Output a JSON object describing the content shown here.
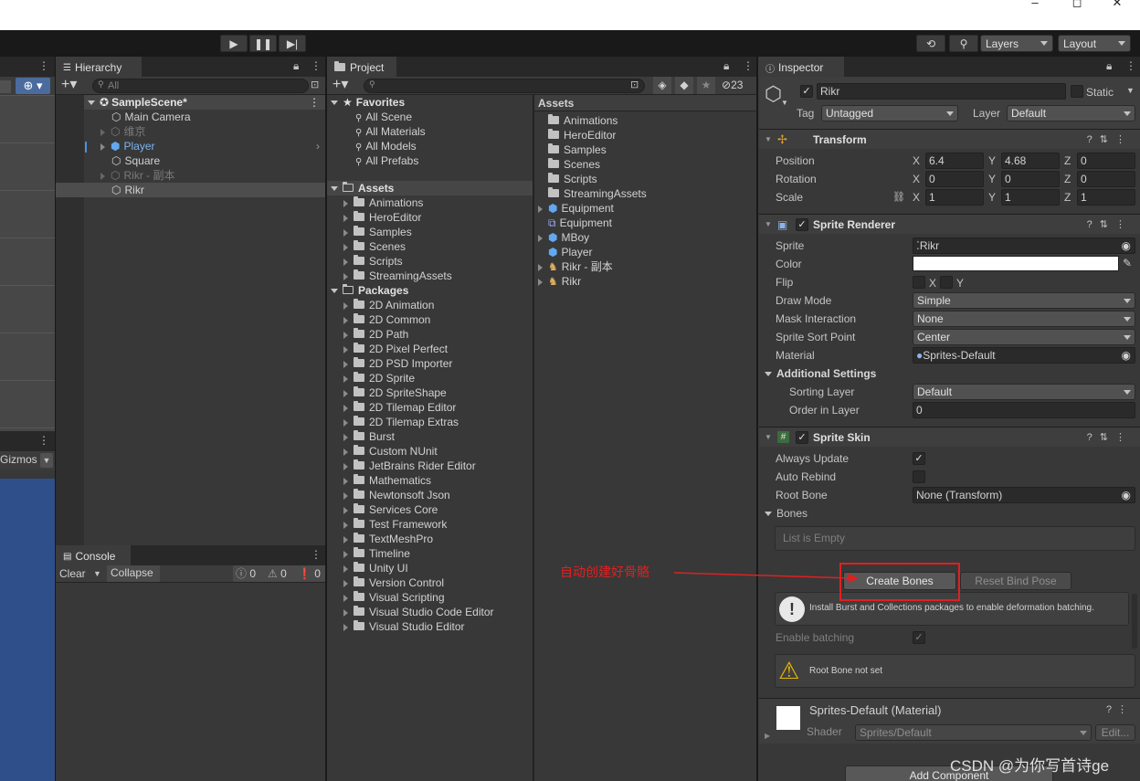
{
  "toolbar": {
    "play_icon": "play-icon",
    "pause_icon": "pause-icon",
    "step_icon": "step-icon",
    "layers": "Layers",
    "layout": "Layout"
  },
  "scene": {
    "gizmos": "Gizmos"
  },
  "hierarchy": {
    "tab": "Hierarchy",
    "search_placeholder": "All",
    "scene": "SampleScene*",
    "items": [
      "Main Camera",
      "维京",
      "Player",
      "Square",
      "Rikr - 副本",
      "Rikr"
    ]
  },
  "console": {
    "tab": "Console",
    "clear": "Clear",
    "collapse": "Collapse",
    "info_count": "0",
    "warn_count": "0",
    "error_count": "0"
  },
  "project": {
    "tab": "Project",
    "hidden_count": "23",
    "favorites_label": "Favorites",
    "favorites": [
      "All Scene",
      "All Materials",
      "All Models",
      "All Prefabs"
    ],
    "assets_label": "Assets",
    "assets_folders": [
      "Animations",
      "HeroEditor",
      "Samples",
      "Scenes",
      "Scripts",
      "StreamingAssets"
    ],
    "packages_label": "Packages",
    "packages": [
      "2D Animation",
      "2D Common",
      "2D Path",
      "2D Pixel Perfect",
      "2D PSD Importer",
      "2D Sprite",
      "2D SpriteShape",
      "2D Tilemap Editor",
      "2D Tilemap Extras",
      "Burst",
      "Custom NUnit",
      "JetBrains Rider Editor",
      "Mathematics",
      "Newtonsoft Json",
      "Services Core",
      "Test Framework",
      "TextMeshPro",
      "Timeline",
      "Unity UI",
      "Version Control",
      "Visual Scripting",
      "Visual Studio Code Editor",
      "Visual Studio Editor"
    ],
    "grid_header": "Assets",
    "grid_items": [
      "Animations",
      "HeroEditor",
      "Samples",
      "Scenes",
      "Scripts",
      "StreamingAssets",
      "Equipment",
      "Equipment",
      "MBoy",
      "Player",
      "Rikr - 副本",
      "Rikr"
    ]
  },
  "inspector": {
    "tab": "Inspector",
    "object_name": "Rikr",
    "static_label": "Static",
    "tag_label": "Tag",
    "tag_value": "Untagged",
    "layer_label": "Layer",
    "layer_value": "Default",
    "transform": {
      "title": "Transform",
      "position_label": "Position",
      "rotation_label": "Rotation",
      "scale_label": "Scale",
      "x": "X",
      "y": "Y",
      "z": "Z",
      "pos": [
        "6.4",
        "4.68",
        "0"
      ],
      "rot": [
        "0",
        "0",
        "0"
      ],
      "scale": [
        "1",
        "1",
        "1"
      ]
    },
    "sprite_renderer": {
      "title": "Sprite Renderer",
      "sprite_label": "Sprite",
      "sprite_value": "Rikr",
      "color_label": "Color",
      "color_value": "#ffffff",
      "flip_label": "Flip",
      "flip_x": "X",
      "flip_y": "Y",
      "draw_mode_label": "Draw Mode",
      "draw_mode_value": "Simple",
      "mask_label": "Mask Interaction",
      "mask_value": "None",
      "sort_point_label": "Sprite Sort Point",
      "sort_point_value": "Center",
      "material_label": "Material",
      "material_value": "Sprites-Default",
      "additional_label": "Additional Settings",
      "sorting_layer_label": "Sorting Layer",
      "sorting_layer_value": "Default",
      "order_label": "Order in Layer",
      "order_value": "0"
    },
    "sprite_skin": {
      "title": "Sprite Skin",
      "always_update_label": "Always Update",
      "auto_rebind_label": "Auto Rebind",
      "root_bone_label": "Root Bone",
      "root_bone_value": "None (Transform)",
      "bones_label": "Bones",
      "list_empty": "List is Empty",
      "create_bones": "Create Bones",
      "reset_bind_pose": "Reset Bind Pose",
      "info_text": "Install Burst and Collections packages to enable deformation batching.",
      "enable_batching_label": "Enable batching",
      "warning_text": "Root Bone not set"
    },
    "material": {
      "title": "Sprites-Default (Material)",
      "shader_label": "Shader",
      "shader_value": "Sprites/Default",
      "edit": "Edit..."
    },
    "add_component": "Add Component"
  },
  "annotation": {
    "text": "自动创建好骨骼",
    "color": "#e02020"
  },
  "watermark": "CSDN @为你写首诗ge"
}
